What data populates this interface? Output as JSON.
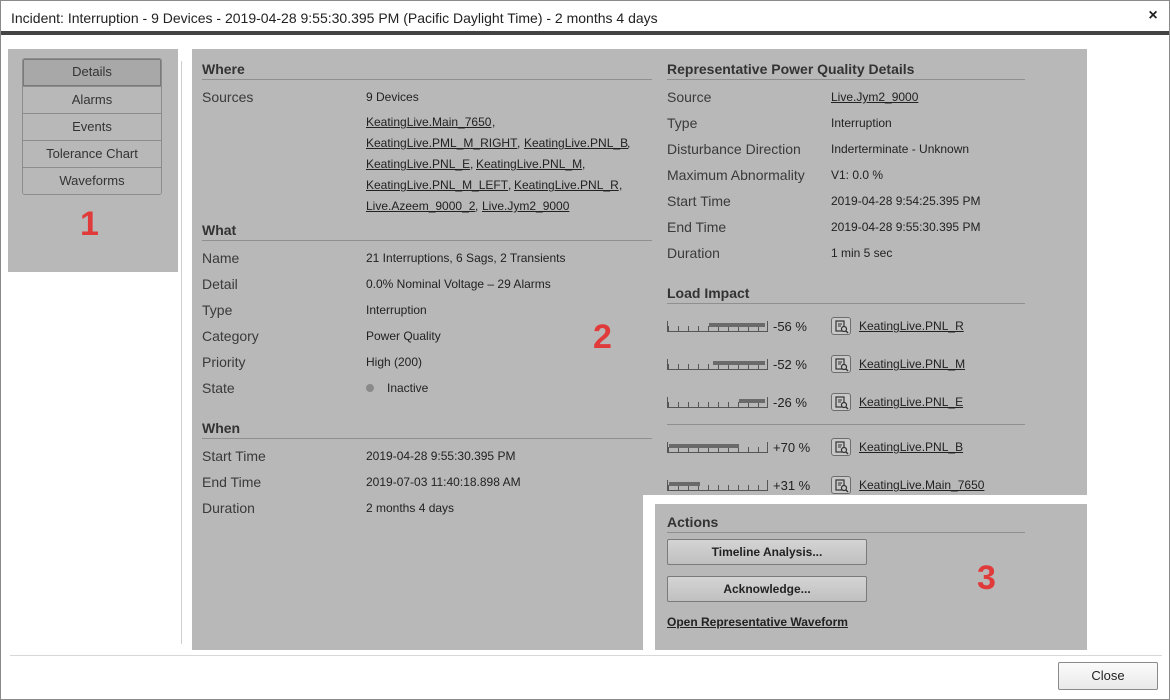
{
  "window": {
    "title": "Incident: Interruption - 9 Devices - 2019-04-28 9:55:30.395 PM (Pacific Daylight Time) - 2 months 4 days",
    "close_glyph": "×"
  },
  "markers": {
    "one": "1",
    "two": "2",
    "three": "3"
  },
  "nav": {
    "items": [
      {
        "label": "Details",
        "active": true
      },
      {
        "label": "Alarms",
        "active": false
      },
      {
        "label": "Events",
        "active": false
      },
      {
        "label": "Tolerance Chart",
        "active": false
      },
      {
        "label": "Waveforms",
        "active": false
      }
    ]
  },
  "where": {
    "heading": "Where",
    "sources_label": "Sources",
    "sources_count": "9 Devices",
    "sources": [
      "KeatingLive.Main_7650",
      "KeatingLive.PML_M_RIGHT",
      "KeatingLive.PNL_B",
      "KeatingLive.PNL_E",
      "KeatingLive.PNL_M",
      "KeatingLive.PNL_M_LEFT",
      "KeatingLive.PNL_R",
      "Live.Azeem_9000_2",
      "Live.Jym2_9000"
    ],
    "separator": ","
  },
  "what": {
    "heading": "What",
    "rows": [
      {
        "label": "Name",
        "value": "21 Interruptions, 6 Sags, 2 Transients"
      },
      {
        "label": "Detail",
        "value": "0.0% Nominal Voltage – 29 Alarms"
      },
      {
        "label": "Type",
        "value": "Interruption"
      },
      {
        "label": "Category",
        "value": "Power Quality"
      },
      {
        "label": "Priority",
        "value": "High (200)"
      },
      {
        "label": "State",
        "value": "Inactive"
      }
    ]
  },
  "when": {
    "heading": "When",
    "rows": [
      {
        "label": "Start Time",
        "value": "2019-04-28 9:55:30.395 PM"
      },
      {
        "label": "End Time",
        "value": "2019-07-03 11:40:18.898 AM"
      },
      {
        "label": "Duration",
        "value": "2 months 4 days"
      }
    ]
  },
  "rpq": {
    "heading": "Representative Power Quality Details",
    "rows": [
      {
        "label": "Source",
        "value": "Live.Jym2_9000",
        "link": true
      },
      {
        "label": "Type",
        "value": "Interruption"
      },
      {
        "label": "Disturbance Direction",
        "value": "Inderterminate - Unknown"
      },
      {
        "label": "Maximum Abnormality",
        "value": "V1: 0.0 %"
      },
      {
        "label": "Start Time",
        "value": "2019-04-28 9:54:25.395 PM"
      },
      {
        "label": "End Time",
        "value": "2019-04-28 9:55:30.395 PM"
      },
      {
        "label": "Duration",
        "value": "1 min 5 sec"
      }
    ]
  },
  "load_impact": {
    "heading": "Load Impact",
    "items": [
      {
        "percent_label": "-56 %",
        "value": -56,
        "device": "KeatingLive.PNL_R"
      },
      {
        "percent_label": "-52 %",
        "value": -52,
        "device": "KeatingLive.PNL_M"
      },
      {
        "percent_label": "-26 %",
        "value": -26,
        "device": "KeatingLive.PNL_E"
      },
      {
        "percent_label": "+70 %",
        "value": 70,
        "device": "KeatingLive.PNL_B"
      },
      {
        "percent_label": "+31 %",
        "value": 31,
        "device": "KeatingLive.Main_7650"
      }
    ]
  },
  "actions": {
    "heading": "Actions",
    "timeline_button": "Timeline Analysis...",
    "acknowledge_button": "Acknowledge...",
    "waveform_link": "Open Representative Waveform"
  },
  "footer": {
    "close_button": "Close"
  },
  "colors": {
    "panel_bg": "#b8b8b8",
    "marker_red": "#e03a3a",
    "title_bar_rule": "#444444"
  }
}
